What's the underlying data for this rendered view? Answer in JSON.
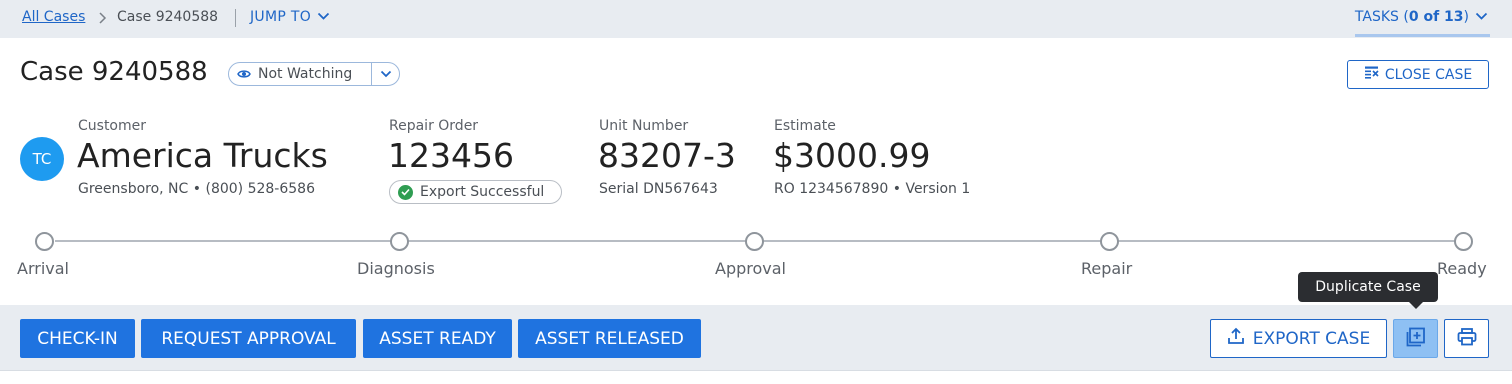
{
  "breadcrumb": {
    "root": "All Cases",
    "current": "Case 9240588",
    "jump_to": "JUMP TO"
  },
  "tasks": {
    "prefix": "TASKS (",
    "count": "0 of 13",
    "suffix": ")"
  },
  "header": {
    "title": "Case 9240588",
    "watch_label": "Not Watching",
    "close_case_label": "CLOSE CASE"
  },
  "customer": {
    "avatar_initials": "TC",
    "label": "Customer",
    "name": "America Trucks",
    "location": "Greensboro, NC",
    "phone": "(800) 528-6586"
  },
  "repair_order": {
    "label": "Repair Order",
    "number": "123456",
    "status": "Export Successful"
  },
  "unit": {
    "label": "Unit Number",
    "number": "83207-3",
    "serial": "Serial DN567643"
  },
  "estimate": {
    "label": "Estimate",
    "amount": "$3000.99",
    "ro": "RO 1234567890",
    "version": "Version 1"
  },
  "progress": {
    "steps": [
      "Arrival",
      "Diagnosis",
      "Approval",
      "Repair",
      "Ready"
    ]
  },
  "actions": {
    "check_in": "CHECK-IN",
    "request_approval": "REQUEST APPROVAL",
    "asset_ready": "ASSET READY",
    "asset_released": "ASSET RELEASED",
    "export_case": "EXPORT CASE",
    "duplicate_tooltip": "Duplicate Case"
  },
  "colors": {
    "accent": "#1f73e0",
    "link": "#1f66c7",
    "success": "#2f9d52",
    "avatar": "#1e9bf0",
    "bar_bg": "#e8ecf1"
  },
  "icons": [
    "chevron-right-icon",
    "chevron-down-icon",
    "eye-icon",
    "close-case-icon",
    "check-circle-icon",
    "upload-icon",
    "duplicate-icon",
    "print-icon"
  ]
}
